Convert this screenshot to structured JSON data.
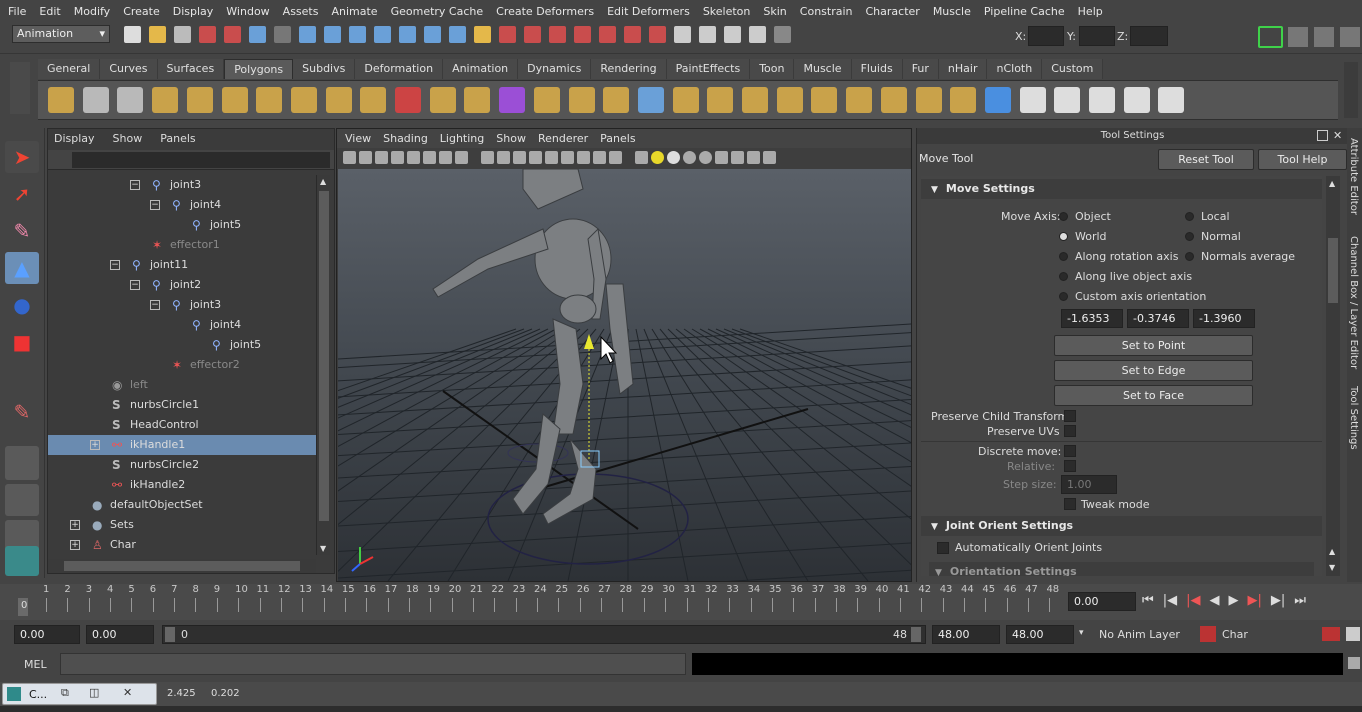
{
  "menubar": [
    "File",
    "Edit",
    "Modify",
    "Create",
    "Display",
    "Window",
    "Assets",
    "Animate",
    "Geometry Cache",
    "Create Deformers",
    "Edit Deformers",
    "Skeleton",
    "Skin",
    "Constrain",
    "Character",
    "Muscle",
    "Pipeline Cache",
    "Help"
  ],
  "toolbar": {
    "mode": "Animation",
    "x_label": "X:",
    "y_label": "Y:",
    "z_label": "Z:"
  },
  "shelf_tabs": [
    "General",
    "Curves",
    "Surfaces",
    "Polygons",
    "Subdivs",
    "Deformation",
    "Animation",
    "Dynamics",
    "Rendering",
    "PaintEffects",
    "Toon",
    "Muscle",
    "Fluids",
    "Fur",
    "nHair",
    "nCloth",
    "Custom"
  ],
  "shelf_active": "Polygons",
  "outliner": {
    "menu": [
      "Display",
      "Show",
      "Panels"
    ],
    "rows": [
      {
        "label": "joint3",
        "indent": 2,
        "type": "joint"
      },
      {
        "label": "joint4",
        "indent": 3,
        "type": "joint"
      },
      {
        "label": "joint5",
        "indent": 4,
        "type": "joint"
      },
      {
        "label": "effector1",
        "indent": 2,
        "type": "effector"
      },
      {
        "label": "joint11",
        "indent": 1,
        "type": "joint"
      },
      {
        "label": "joint2",
        "indent": 2,
        "type": "joint"
      },
      {
        "label": "joint3",
        "indent": 3,
        "type": "joint"
      },
      {
        "label": "joint4",
        "indent": 4,
        "type": "joint"
      },
      {
        "label": "joint5",
        "indent": 5,
        "type": "joint"
      },
      {
        "label": "effector2",
        "indent": 3,
        "type": "effector"
      },
      {
        "label": "left",
        "indent": 0,
        "type": "dim"
      },
      {
        "label": "nurbsCircle1",
        "indent": 0,
        "type": "curve"
      },
      {
        "label": "HeadControl",
        "indent": 0,
        "type": "curve"
      },
      {
        "label": "ikHandle1",
        "indent": 0,
        "type": "ik",
        "selected": true
      },
      {
        "label": "nurbsCircle2",
        "indent": 0,
        "type": "curve"
      },
      {
        "label": "ikHandle2",
        "indent": 0,
        "type": "ik"
      },
      {
        "label": "defaultObjectSet",
        "indent": -1,
        "type": "set"
      },
      {
        "label": "Sets",
        "indent": -1,
        "type": "set"
      },
      {
        "label": "Char",
        "indent": -1,
        "type": "char"
      }
    ]
  },
  "viewport": {
    "menu": [
      "View",
      "Shading",
      "Lighting",
      "Show",
      "Renderer",
      "Panels"
    ]
  },
  "tool_settings": {
    "panel_title": "Tool Settings",
    "tool_name": "Move Tool",
    "reset_label": "Reset Tool",
    "help_label": "Tool Help",
    "move_settings": "Move Settings",
    "move_axis_label": "Move Axis:",
    "axis_left": [
      "Object",
      "World",
      "Along rotation axis",
      "Along live object axis",
      "Custom axis orientation"
    ],
    "axis_right": [
      "Local",
      "Normal",
      "Normals average"
    ],
    "selected_axis": "World",
    "values": [
      "-1.6353",
      "-0.3746",
      "-1.3960"
    ],
    "set_buttons": [
      "Set to Point",
      "Set to Edge",
      "Set to Face"
    ],
    "preserve_child": "Preserve Child Transform",
    "preserve_uvs": "Preserve UVs",
    "discrete_move": "Discrete move:",
    "relative": "Relative:",
    "step_size": "Step size:",
    "step_value": "1.00",
    "tweak_mode": "Tweak mode",
    "joint_orient": "Joint Orient Settings",
    "auto_orient": "Automatically Orient Joints",
    "orientation": "Orientation Settings"
  },
  "side_tabs": [
    "Attribute Editor",
    "Channel Box / Layer Editor",
    "Tool Settings"
  ],
  "timeline": {
    "ticks": [
      "1",
      "2",
      "3",
      "4",
      "5",
      "6",
      "7",
      "8",
      "9",
      "10",
      "11",
      "12",
      "13",
      "14",
      "15",
      "16",
      "17",
      "18",
      "19",
      "20",
      "21",
      "22",
      "23",
      "24",
      "25",
      "26",
      "27",
      "28",
      "29",
      "30",
      "31",
      "32",
      "33",
      "34",
      "35",
      "36",
      "37",
      "38",
      "39",
      "40",
      "41",
      "42",
      "43",
      "44",
      "45",
      "46",
      "47",
      "48"
    ],
    "current_frame": "0",
    "current_time": "0.00"
  },
  "range": {
    "start": "0.00",
    "anim_start": "0.00",
    "range_start": "0",
    "range_end": "48",
    "anim_end": "48.00",
    "end": "48.00",
    "anim_layer": "No Anim Layer",
    "character": "Char"
  },
  "mel_label": "MEL",
  "status": {
    "task_label": "C...",
    "val1": "2.425",
    "val2": "0.202"
  }
}
